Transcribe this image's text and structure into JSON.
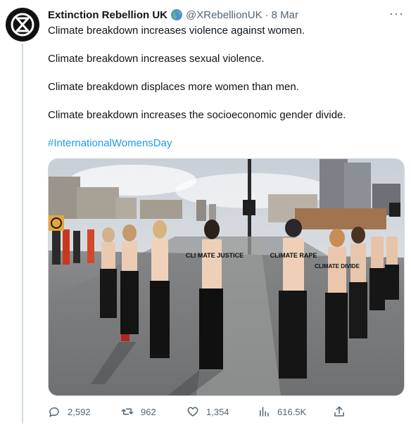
{
  "tweet": {
    "author_name": "Extinction Rebellion UK",
    "handle": "@XRebellionUK",
    "separator": "·",
    "date": "8 Mar",
    "more_label": "···",
    "paragraphs": [
      "Climate breakdown increases violence against women.",
      "Climate breakdown increases sexual violence.",
      "Climate breakdown displaces more women than men.",
      "Climate breakdown increases the socioeconomic gender divide."
    ],
    "hashtag": "#InternationalWomensDay",
    "photo_sign_texts": [
      "CLIMATE RAPE",
      "CLI MATE JUSTICE",
      "CLIMATE DIVIDE"
    ]
  },
  "actions": {
    "replies": "2,592",
    "retweets": "962",
    "likes": "1,354",
    "views": "616.5K"
  },
  "colors": {
    "text": "#0f1419",
    "secondary": "#536471",
    "link": "#1d9bf0",
    "border": "#cfd9de"
  },
  "icons": [
    "xr-logo-icon",
    "globe-badge-icon",
    "more-icon",
    "reply-icon",
    "retweet-icon",
    "like-icon",
    "views-icon",
    "share-icon"
  ]
}
